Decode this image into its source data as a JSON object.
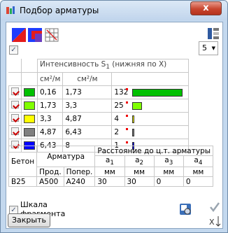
{
  "window": {
    "title": "Подбор арматуры",
    "close_label": "x"
  },
  "toolbar": {
    "dropdown_value": "5"
  },
  "table1": {
    "header_main": "Интенсивность S",
    "header_sub": "1",
    "header_tail": " (нижняя по X)",
    "col1_unit": "см²/м",
    "col2_unit": "см²/м",
    "rows": [
      {
        "color": "#00c000",
        "from": "0,16",
        "to": "1,73",
        "count": "132",
        "bar_fraction": 1.0
      },
      {
        "color": "#80ff00",
        "from": "1,73",
        "to": "3,3",
        "count": "25",
        "bar_fraction": 0.19
      },
      {
        "color": "#ffff00",
        "from": "3,3",
        "to": "4,87",
        "count": "4",
        "bar_fraction": 0.03
      },
      {
        "color": "#808080",
        "from": "4,87",
        "to": "6,43",
        "count": "2",
        "bar_fraction": 0.015
      },
      {
        "color": "#0000ff",
        "from": "6,43",
        "to": "8",
        "count": "1",
        "bar_fraction": 0.008
      }
    ]
  },
  "table2": {
    "beton": "Бетон",
    "armatura": "Арматура",
    "distance": "Расстояние до ц.т. арматуры",
    "a1": "a",
    "a1s": "1",
    "a2": "a",
    "a2s": "2",
    "a3": "a",
    "a3s": "3",
    "a4": "a",
    "a4s": "4",
    "prod": "Прод.",
    "poper": "Попер.",
    "mm": "мм",
    "row": {
      "beton": "B25",
      "prod": "A500",
      "poper": "A240",
      "a1": "30",
      "a2": "30",
      "a3": "0",
      "a4": "0"
    }
  },
  "footer": {
    "scale_label_1": "Шкала",
    "scale_label_2": "фрагмента",
    "close_button": "Закрыть"
  }
}
